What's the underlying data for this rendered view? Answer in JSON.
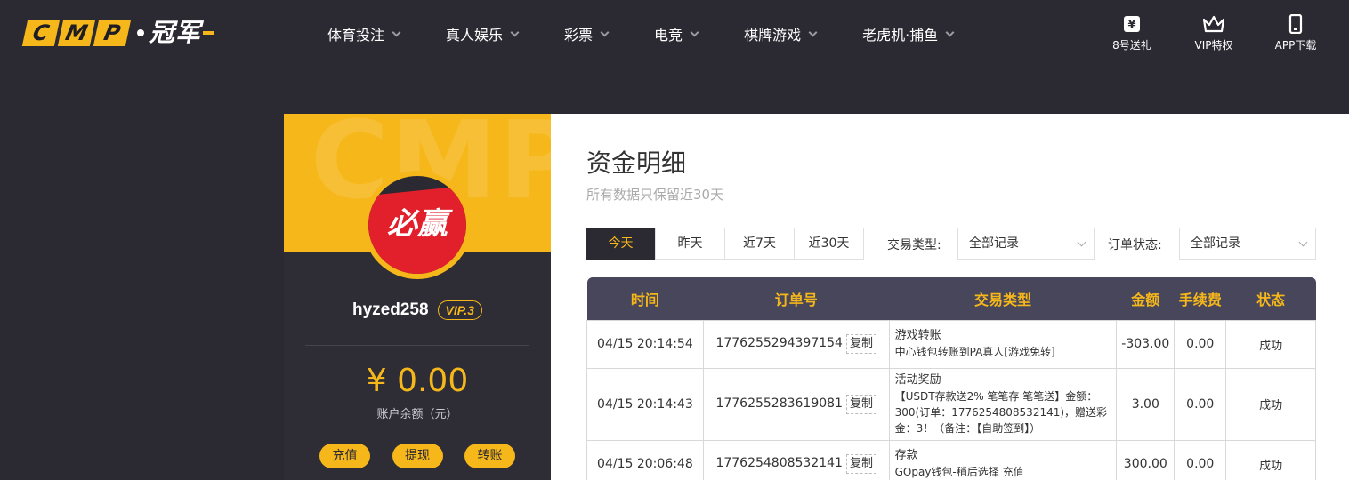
{
  "header": {
    "logo_letters": [
      "C",
      "M",
      "P"
    ],
    "logo_cn": "冠军",
    "nav": [
      {
        "label": "体育投注"
      },
      {
        "label": "真人娱乐"
      },
      {
        "label": "彩票"
      },
      {
        "label": "电竞"
      },
      {
        "label": "棋牌游戏"
      },
      {
        "label": "老虎机·捕鱼"
      }
    ],
    "actions": [
      {
        "label": "8号送礼",
        "icon": "gift-ticket-icon"
      },
      {
        "label": "VIP特权",
        "icon": "crown-icon"
      },
      {
        "label": "APP下载",
        "icon": "phone-icon"
      }
    ]
  },
  "sidebar": {
    "watermark": "CMP",
    "avatar_text": "必赢",
    "username": "hyzed258",
    "vip": "VIP.3",
    "balance": "¥ 0.00",
    "balance_label": "账户余额（元）",
    "buttons": [
      "充值",
      "提现",
      "转账"
    ]
  },
  "main": {
    "title": "资金明细",
    "subtitle": "所有数据只保留近30天",
    "date_tabs": [
      "今天",
      "昨天",
      "近7天",
      "近30天"
    ],
    "active_tab": 0,
    "filters": {
      "type_label": "交易类型:",
      "type_value": "全部记录",
      "status_label": "订单状态:",
      "status_value": "全部记录"
    },
    "table": {
      "headers": [
        "时间",
        "订单号",
        "交易类型",
        "金额",
        "手续费",
        "状态"
      ],
      "copy_label": "复制",
      "rows": [
        {
          "time": "04/15 20:14:54",
          "order": "1776255294397154",
          "type": "游戏转账",
          "desc": "中心钱包转账到PA真人[游戏免转]",
          "amount": "-303.00",
          "fee": "0.00",
          "status": "成功"
        },
        {
          "time": "04/15 20:14:43",
          "order": "1776255283619081",
          "type": "活动奖励",
          "desc": "【USDT存款送2% 笔笔存 笔笔送】金额：300(订单：1776254808532141)，赠送彩金：3！（备注：【自助签到】）",
          "amount": "3.00",
          "fee": "0.00",
          "status": "成功"
        },
        {
          "time": "04/15 20:06:48",
          "order": "1776254808532141",
          "type": "存款",
          "desc": "GOpay钱包-稍后选择 充值",
          "amount": "300.00",
          "fee": "0.00",
          "status": "成功"
        }
      ]
    }
  },
  "colors": {
    "accent": "#f6b71a",
    "header_bg": "#2b2a33",
    "table_header_bg": "#47465a",
    "success": "#3d9a2b"
  }
}
